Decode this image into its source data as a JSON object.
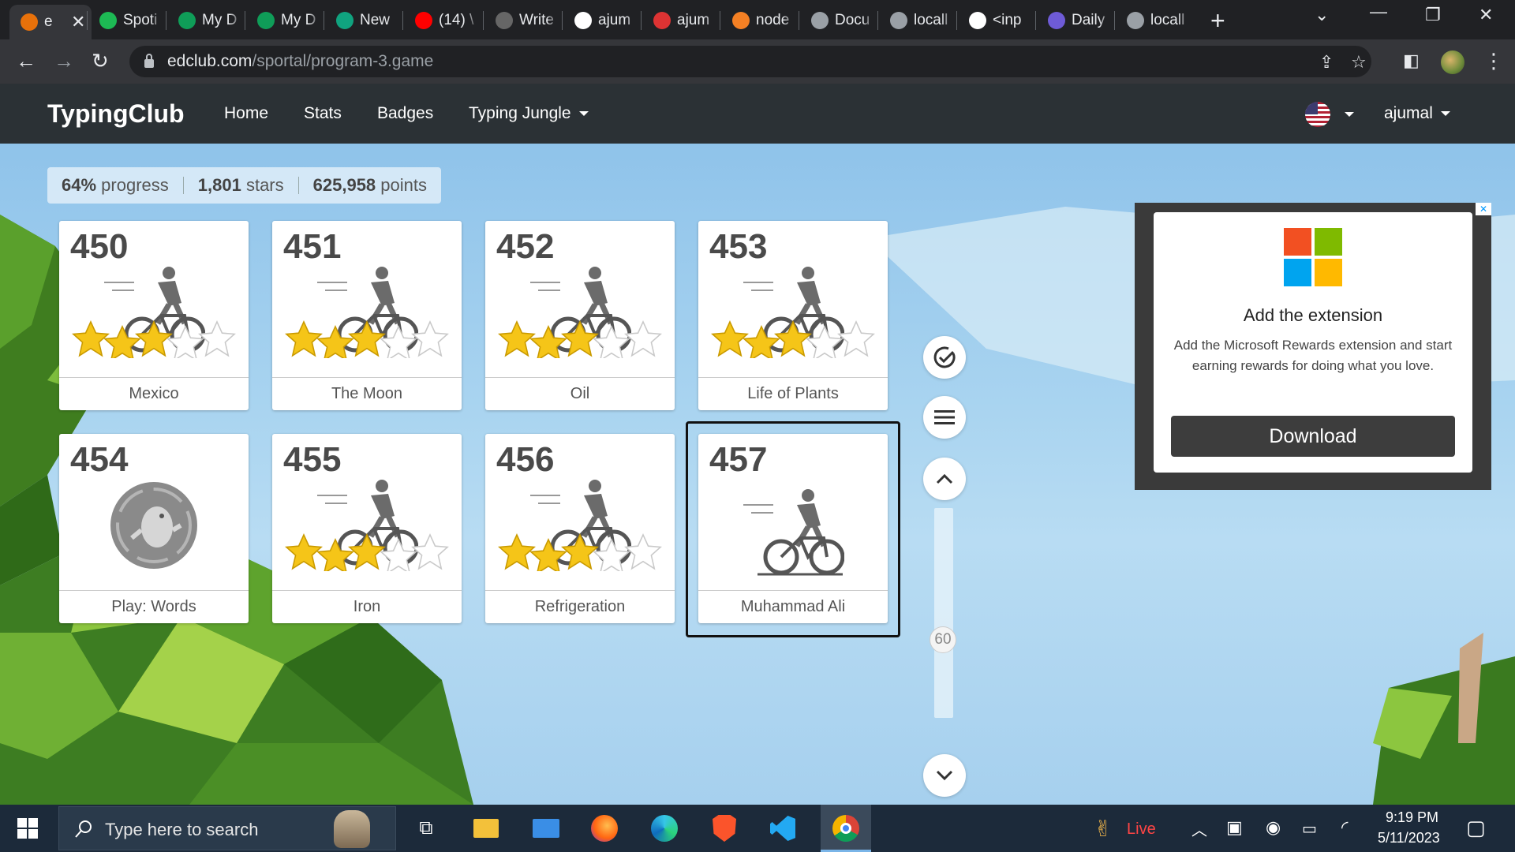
{
  "browser": {
    "tabs": [
      {
        "label": "e",
        "icon": "typingclub-favicon",
        "color": "#e8710a",
        "active": true
      },
      {
        "label": "Spoti",
        "icon": "spotify-icon",
        "color": "#1db954"
      },
      {
        "label": "My D",
        "icon": "google-drive-icon",
        "color": "#0f9d58"
      },
      {
        "label": "My D",
        "icon": "google-drive-icon",
        "color": "#0f9d58"
      },
      {
        "label": "New",
        "icon": "chatgpt-icon",
        "color": "#10a37f"
      },
      {
        "label": "(14) \\",
        "icon": "youtube-icon",
        "color": "#ff0000"
      },
      {
        "label": "Write",
        "icon": "write-icon",
        "color": "#666666"
      },
      {
        "label": "ajum",
        "icon": "github-icon",
        "color": "#ffffff"
      },
      {
        "label": "ajum",
        "icon": "codepen-icon",
        "color": "#d33"
      },
      {
        "label": "node",
        "icon": "stackoverflow-icon",
        "color": "#f48024"
      },
      {
        "label": "Docu",
        "icon": "globe-icon",
        "color": "#9aa0a6"
      },
      {
        "label": "locall",
        "icon": "globe-icon",
        "color": "#9aa0a6"
      },
      {
        "label": "<inp",
        "icon": "medium-icon",
        "color": "#ffffff"
      },
      {
        "label": "Daily",
        "icon": "daily-icon",
        "color": "#6e5bd7"
      },
      {
        "label": "locall",
        "icon": "globe-icon",
        "color": "#9aa0a6"
      }
    ],
    "url_host": "edclub.com",
    "url_path": "/sportal/program-3.game"
  },
  "site": {
    "brand": "TypingClub",
    "nav": {
      "home": "Home",
      "stats": "Stats",
      "badges": "Badges",
      "jungle": "Typing Jungle"
    },
    "user": "ajumal"
  },
  "progress": {
    "percent": "64%",
    "percent_label": "progress",
    "stars": "1,801",
    "stars_label": "stars",
    "points": "625,958",
    "points_label": "points"
  },
  "lessons": [
    {
      "number": "450",
      "title": "Mexico",
      "type": "bike",
      "stars": 3
    },
    {
      "number": "451",
      "title": "The Moon",
      "type": "bike",
      "stars": 3
    },
    {
      "number": "452",
      "title": "Oil",
      "type": "bike",
      "stars": 3
    },
    {
      "number": "453",
      "title": "Life of Plants",
      "type": "bike",
      "stars": 3
    },
    {
      "number": "454",
      "title": "Play: Words",
      "type": "game",
      "stars": 0
    },
    {
      "number": "455",
      "title": "Iron",
      "type": "bike",
      "stars": 3
    },
    {
      "number": "456",
      "title": "Refrigeration",
      "type": "bike",
      "stars": 3
    },
    {
      "number": "457",
      "title": "Muhammad Ali",
      "type": "bike",
      "stars": 0,
      "selected": true
    }
  ],
  "slider": {
    "value": "60"
  },
  "ad": {
    "title": "Add the extension",
    "body": "Add the Microsoft Rewards extension and start earning rewards for doing what you love.",
    "button": "Download"
  },
  "taskbar": {
    "search_placeholder": "Type here to search",
    "live_label": "Live",
    "time": "9:19 PM",
    "date": "5/11/2023"
  },
  "colors": {
    "star": "#f5c518",
    "header": "#2b3135",
    "chrome": "#202124"
  }
}
